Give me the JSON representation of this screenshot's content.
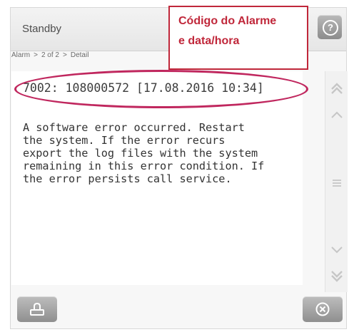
{
  "header": {
    "title": "Standby"
  },
  "callout": {
    "line1": "Código do Alarme",
    "line2": "e data/hora"
  },
  "breadcrumb": {
    "root": "Alarm",
    "sep1": ">",
    "position": "2 of 2",
    "sep2": ">",
    "current": "Detail"
  },
  "alarm": {
    "code_line": "7002: 108000572 [17.08.2016 10:34]",
    "message_lines": [
      "A software error occurred. Restart",
      "the system. If the error recurs",
      "export the log files with the system",
      "remaining in this error condition. If",
      "the error persists call service."
    ]
  },
  "icons": {
    "help": "help-icon",
    "scroll_top": "double-chevron-up-icon",
    "scroll_up": "chevron-up-icon",
    "scroll_thumb": "grip-icon",
    "scroll_down": "chevron-down-icon",
    "scroll_bottom": "double-chevron-down-icon",
    "acknowledge": "acknowledge-icon",
    "close": "close-icon"
  },
  "colors": {
    "annotation": "#c0273a",
    "highlight": "#c0275e",
    "button": "#9e9e9e"
  }
}
